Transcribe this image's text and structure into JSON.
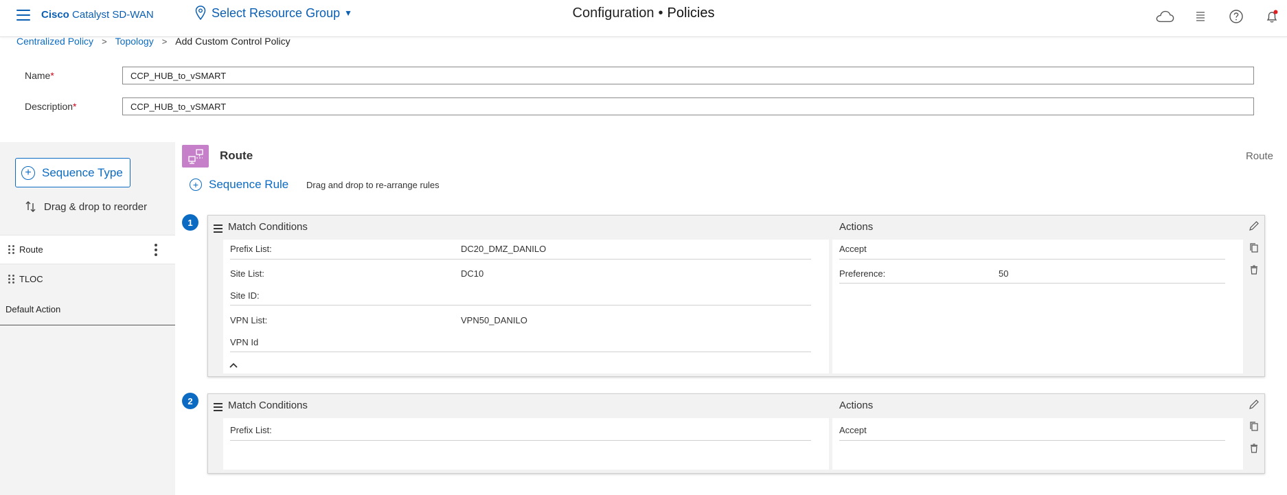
{
  "header": {
    "brand_bold": "Cisco",
    "brand_rest": "Catalyst SD-WAN",
    "resource_group": "Select Resource Group",
    "title_left": "Configuration",
    "title_sep": "•",
    "title_right": "Policies"
  },
  "breadcrumb": {
    "items": [
      "Centralized Policy",
      "Topology"
    ],
    "current": "Add Custom Control Policy"
  },
  "form": {
    "name_label": "Name",
    "name_value": "CCP_HUB_to_vSMART",
    "description_label": "Description",
    "description_value": "CCP_HUB_to_vSMART",
    "required_mark": "*"
  },
  "left_panel": {
    "sequence_type_label": "Sequence Type",
    "drag_reorder_label": "Drag & drop to reorder",
    "items": [
      {
        "label": "Route"
      },
      {
        "label": "TLOC"
      }
    ],
    "default_action": "Default Action"
  },
  "main": {
    "section_title": "Route",
    "section_type": "Route",
    "sequence_rule_label": "Sequence Rule",
    "sequence_rule_hint": "Drag and drop to re-arrange rules",
    "rules": [
      {
        "number": "1",
        "match_title": "Match Conditions",
        "actions_title": "Actions",
        "match": [
          {
            "label": "Prefix List:",
            "value": "DC20_DMZ_DANILO"
          },
          {
            "label": "Site List:",
            "value": "DC10"
          },
          {
            "label": "Site ID:",
            "value": ""
          },
          {
            "label": "VPN List:",
            "value": "VPN50_DANILO"
          },
          {
            "label": "VPN Id",
            "value": ""
          }
        ],
        "actions": [
          {
            "label": "Accept",
            "value": ""
          },
          {
            "label": "Preference:",
            "value": "50"
          }
        ]
      },
      {
        "number": "2",
        "match_title": "Match Conditions",
        "actions_title": "Actions",
        "match": [
          {
            "label": "Prefix List:",
            "value": ""
          }
        ],
        "actions": [
          {
            "label": "Accept",
            "value": ""
          }
        ]
      }
    ]
  },
  "colors": {
    "brand_blue": "#0b5fb3",
    "route_icon": "#c67fc9",
    "required": "#d0021b",
    "notification_dot": "#e02020"
  },
  "icons": [
    "menu-icon",
    "location-pin-icon",
    "cloud-icon",
    "list-icon",
    "help-icon",
    "bell-icon",
    "pencil-icon",
    "copy-icon",
    "trash-icon",
    "chevron-up-icon"
  ]
}
